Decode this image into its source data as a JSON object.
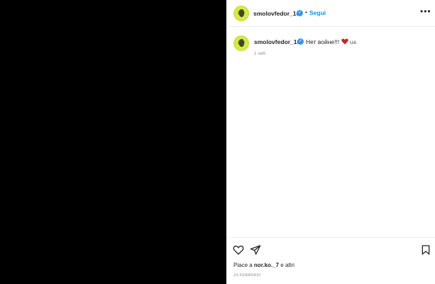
{
  "post": {
    "author": "smolovfedor_10",
    "follow_label": "Segui",
    "separator": "•",
    "more_label": "•••",
    "caption_text": "Нет войне!!!",
    "caption_flag": "UA",
    "time_ago": "1 sett.",
    "likes_prefix": "Piace a",
    "likes_user": "nor.ko._7",
    "likes_suffix": "e altri",
    "date": "24 FEBBRAIO",
    "verified_mark": "✓"
  },
  "icons": {
    "like": "heart-outline-icon",
    "share": "paper-plane-icon",
    "save": "bookmark-icon",
    "caption_heart": "red-heart-emoji"
  },
  "colors": {
    "accent": "#0095f6",
    "verified": "#3897f0",
    "text": "#262626",
    "muted": "#8e8e8e",
    "heart": "#c62828"
  }
}
